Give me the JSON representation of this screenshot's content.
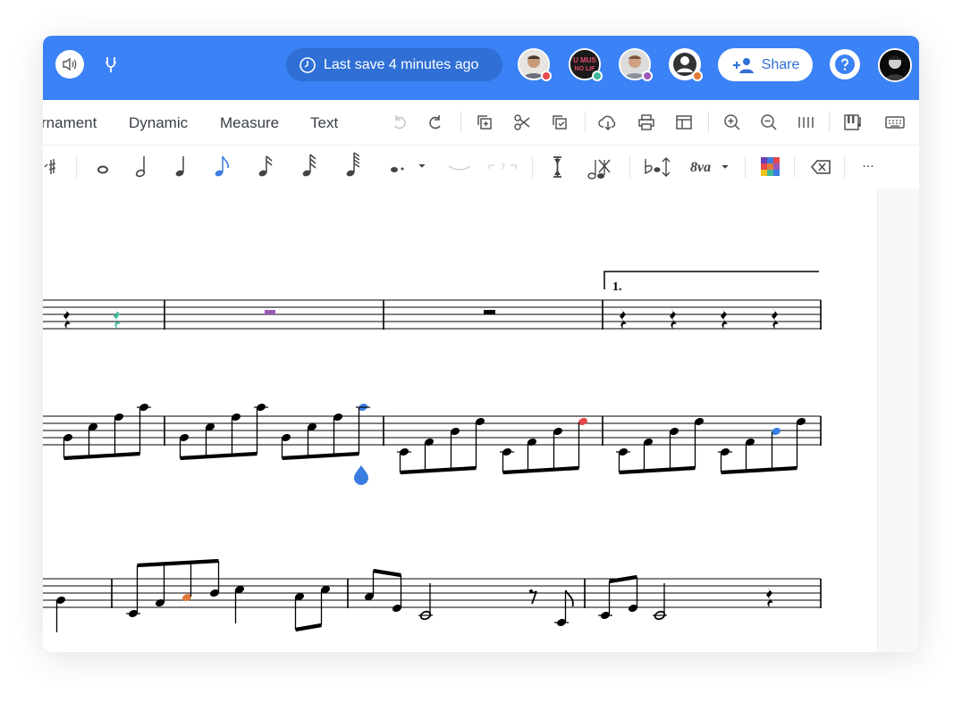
{
  "topbar": {
    "save_status": "Last save 4 minutes ago",
    "share_label": "Share",
    "avatar_text": "U MUS NO LIF",
    "colors": {
      "brand": "#3b82f6",
      "pill": "#2f6fd6"
    }
  },
  "menu": {
    "items": [
      "rnament",
      "Dynamic",
      "Measure",
      "Text"
    ]
  },
  "toolbar": {
    "icons": [
      "undo-icon",
      "redo-icon",
      "copy-icon",
      "cut-icon",
      "paste-icon",
      "cloud-icon",
      "print-icon",
      "layout-icon",
      "zoom-in-icon",
      "zoom-out-icon",
      "barlines-icon",
      "piano-icon",
      "keyboard-icon"
    ]
  },
  "notes": {
    "tuplet_label": "3",
    "ottava_label": "8va",
    "more_label": "···"
  },
  "score": {
    "volta_label": "1.",
    "highlight_colors": {
      "teal": "#3fb99b",
      "purple": "#9b59b6",
      "blue": "#3a7de0",
      "red": "#e5484d",
      "orange": "#e07b39"
    }
  }
}
